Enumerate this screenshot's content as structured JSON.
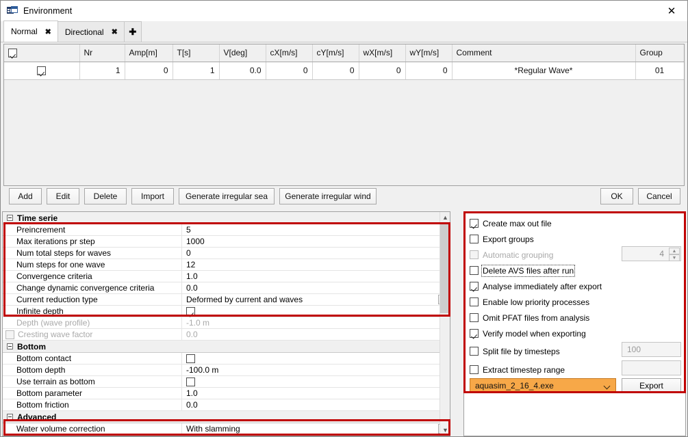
{
  "window": {
    "title": "Environment",
    "icon": "environment-form-icon",
    "close_label": "✕"
  },
  "tabs": {
    "items": [
      {
        "label": "Normal",
        "close": "✖",
        "active": true
      },
      {
        "label": "Directional",
        "close": "✖",
        "active": false
      }
    ],
    "add_label": "✚"
  },
  "grid": {
    "columns": [
      "",
      "Nr",
      "Amp[m]",
      "T[s]",
      "V[deg]",
      "cX[m/s]",
      "cY[m/s]",
      "wX[m/s]",
      "wY[m/s]",
      "Comment",
      "Group"
    ],
    "header_checkbox_checked": true,
    "rows": [
      {
        "checked": true,
        "nr": "1",
        "amp": "0",
        "t": "1",
        "v": "0.0",
        "cx": "0",
        "cy": "0",
        "wx": "0",
        "wy": "0",
        "comment": "*Regular Wave*",
        "group": "01"
      }
    ]
  },
  "actions": {
    "add": "Add",
    "edit": "Edit",
    "delete": "Delete",
    "import": "Import",
    "gen_sea": "Generate irregular sea",
    "gen_wind": "Generate irregular wind",
    "ok": "OK",
    "cancel": "Cancel"
  },
  "properties": {
    "sections": [
      {
        "name": "Time serie",
        "rows": [
          {
            "label": "Preincrement",
            "value": "5",
            "kind": "text"
          },
          {
            "label": "Max iterations pr step",
            "value": "1000",
            "kind": "text"
          },
          {
            "label": "Num total steps for waves",
            "value": "0",
            "kind": "text"
          },
          {
            "label": "Num steps for one wave",
            "value": "12",
            "kind": "text"
          },
          {
            "label": "Convergence criteria",
            "value": "1.0",
            "kind": "text"
          },
          {
            "label": "Change dynamic convergence criteria",
            "value": "0.0",
            "kind": "text"
          },
          {
            "label": "Current reduction type",
            "value": "Deformed by current and waves",
            "kind": "dropdown"
          },
          {
            "label": "Infinite depth",
            "value": "",
            "kind": "checkbox",
            "checked": true
          },
          {
            "label": "Depth (wave profile)",
            "value": "-1.0 m",
            "kind": "text",
            "disabled": true
          },
          {
            "label": "Cresting wave factor",
            "value": "0.0",
            "kind": "checkbox-label",
            "checked": false,
            "disabled": true
          }
        ]
      },
      {
        "name": "Bottom",
        "rows": [
          {
            "label": "Bottom contact",
            "value": "",
            "kind": "checkbox",
            "checked": false
          },
          {
            "label": "Bottom depth",
            "value": "-100.0 m",
            "kind": "text"
          },
          {
            "label": "Use terrain as bottom",
            "value": "",
            "kind": "checkbox",
            "checked": false
          },
          {
            "label": "Bottom parameter",
            "value": "1.0",
            "kind": "text"
          },
          {
            "label": "Bottom friction",
            "value": "0.0",
            "kind": "text"
          }
        ]
      },
      {
        "name": "Advanced",
        "rows": [
          {
            "label": "Water volume correction",
            "value": "With slamming",
            "kind": "dropdown"
          }
        ]
      }
    ]
  },
  "options": {
    "items": [
      {
        "label": "Create max out file",
        "checked": true,
        "disabled": false,
        "focused": false
      },
      {
        "label": "Export groups",
        "checked": false,
        "disabled": false,
        "focused": false
      },
      {
        "label": "Automatic grouping",
        "checked": false,
        "disabled": true,
        "focused": false
      },
      {
        "label": "Delete AVS files after run",
        "checked": false,
        "disabled": false,
        "focused": true
      },
      {
        "label": "Analyse immediately after export",
        "checked": true,
        "disabled": false,
        "focused": false
      },
      {
        "label": "Enable low priority processes",
        "checked": false,
        "disabled": false,
        "focused": false
      },
      {
        "label": "Omit PFAT files from analysis",
        "checked": false,
        "disabled": false,
        "focused": false
      },
      {
        "label": "Verify model when exporting",
        "checked": true,
        "disabled": false,
        "focused": false
      },
      {
        "label": "Split file by timesteps",
        "checked": false,
        "disabled": false,
        "focused": false
      },
      {
        "label": "Extract timestep range",
        "checked": false,
        "disabled": false,
        "focused": false
      }
    ],
    "grouping_count": "4",
    "split_timesteps_value": "100",
    "extract_range_value": "",
    "solver_selected": "aquasim_2_16_4.exe",
    "export_label": "Export"
  },
  "annotations": {
    "color": "#c00000",
    "boxes": [
      {
        "name": "time-serie-settings-highlight"
      },
      {
        "name": "water-volume-correction-highlight"
      },
      {
        "name": "export-options-highlight"
      }
    ]
  }
}
